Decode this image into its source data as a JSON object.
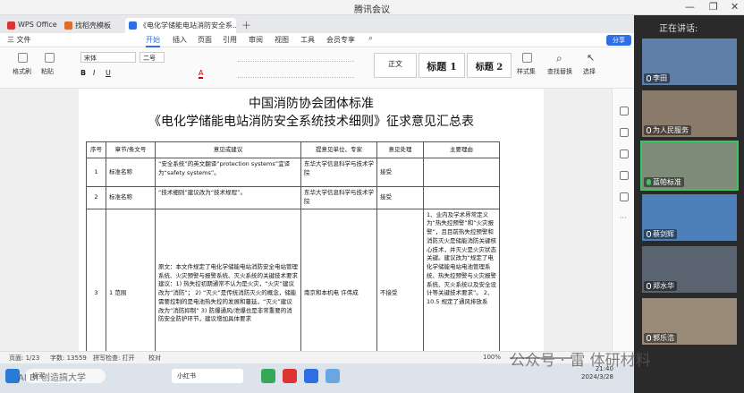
{
  "meeting": {
    "title": "腾讯会议",
    "speaking_label": "正在讲话:"
  },
  "participants": [
    {
      "name": "李田",
      "mic": "off"
    },
    {
      "name": "为人民服务",
      "mic": "off"
    },
    {
      "name": "蓝帕标准",
      "mic": "on"
    },
    {
      "name": "蔡剑辉",
      "mic": "off"
    },
    {
      "name": "郑水华",
      "mic": "off"
    },
    {
      "name": "郭乐浩",
      "mic": "off"
    }
  ],
  "wps": {
    "tabs": [
      {
        "label": "WPS Office",
        "icon": "wps-logo-icon"
      },
      {
        "label": "找稻壳模板",
        "icon": "template-icon"
      },
      {
        "label": "《电化学储能电站消防安全系...",
        "icon": "word-doc-icon"
      }
    ],
    "menu": [
      {
        "label": "三 文件",
        "active": false
      },
      {
        "label": "开始",
        "active": true
      },
      {
        "label": "插入",
        "active": false
      },
      {
        "label": "页面",
        "active": false
      },
      {
        "label": "引用",
        "active": false
      },
      {
        "label": "审阅",
        "active": false
      },
      {
        "label": "视图",
        "active": false
      },
      {
        "label": "工具",
        "active": false
      },
      {
        "label": "会员专享",
        "active": false
      }
    ],
    "share_label": "分享",
    "ribbon": {
      "format_painter": "格式刷",
      "paste": "粘贴",
      "font_name": "宋体",
      "font_size": "二号",
      "style_normal": "正文",
      "style_h1": "标题 1",
      "style_h2": "标题 2",
      "styles": "样式集",
      "find_replace": "查找替换",
      "select": "选择"
    },
    "document": {
      "title_line1": "中国消防协会团体标准",
      "title_line2": "《电化学储能电站消防安全系统技术细则》征求意见汇总表",
      "headers": [
        "序号",
        "章节/条文号",
        "意见或建议",
        "提意见单位、专家",
        "意见处理",
        "主要理由"
      ],
      "rows": [
        {
          "no": "1",
          "clause": "标准名称",
          "opinion": "“安全系统”的英文翻译“protection systems”宜译为“safety systems”。",
          "unit": "东华大学信息科学与技术学院",
          "handling": "接受",
          "reason": ""
        },
        {
          "no": "2",
          "clause": "标准名称",
          "opinion": "“技术细则”建议改为“技术规程”。",
          "unit": "东华大学信息科学与技术学院",
          "handling": "接受",
          "reason": ""
        },
        {
          "no": "3",
          "clause": "1 范围",
          "opinion": "原文：本文件规定了电化学储能电站消防安全电站管理系统、火灾预警与报警系统、灭火系统的关键技术要求建议：1) 热失控初期通常不认为是火灾，“火灾”建议改为“消防”； 2) “灭火”是传统消防灭火的概念，储能需要控制的是电池热失控的发展和蔓延，“灭火”建议改为“消防抑制” 3) 防爆通风/泄爆也是非常重要的消防安全防护环节，建议增加具体要求",
          "unit": "南京和本机电 许伟成",
          "handling": "不接受",
          "reason": "1、业内及学术界常定义为“热失控预警”和“火灾报警”，且目前热失控预警和消防灭火是储能消防关键核心技术，并灭火是火灾状态关键。建议改为“规定了电化学储能电站电池管理系统、热失控预警与火灾报警系统、灭火系统以及安全设计等关键技术要求”。 2、10.5 规定了通风排放系"
        }
      ]
    },
    "status": {
      "page": "页面: 1/23",
      "words": "字数: 13559",
      "spell": "拼写检查: 打开",
      "proof": "校对",
      "zoom": "100%"
    }
  },
  "taskbar": {
    "search_label": "搜索",
    "app_label": "小红书",
    "time": "21:40",
    "date": "2024/3/28"
  },
  "watermark": {
    "right": "公众号 · 雷 体研材料",
    "left": "AI BI 创造搞大学"
  }
}
